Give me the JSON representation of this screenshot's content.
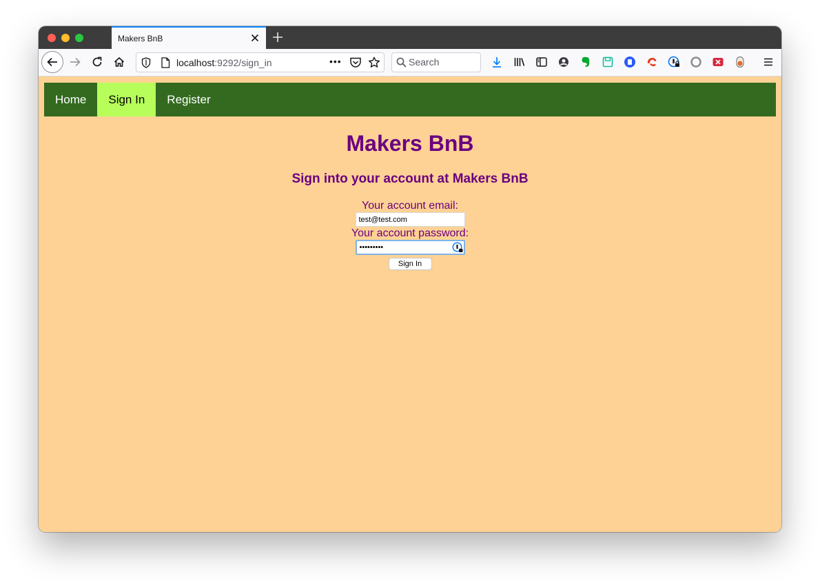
{
  "browser": {
    "tab_title": "Makers BnB",
    "url_host": "localhost",
    "url_rest": ":9292/sign_in",
    "search_placeholder": "Search",
    "page_actions_glyph": "•••"
  },
  "icons": [
    "back-arrow-icon",
    "forward-arrow-icon",
    "reload-icon",
    "home-icon",
    "shield-icon",
    "page-icon",
    "pocket-icon",
    "star-icon",
    "search-icon",
    "download-icon",
    "library-icon",
    "sidebar-icon",
    "account-icon",
    "evernote-icon",
    "save-icon",
    "extension-blue-icon",
    "extension-red-icon",
    "password-manager-icon",
    "extension-grey-icon",
    "extension-close-icon",
    "extension-toggle-icon",
    "menu-icon"
  ],
  "colors": {
    "nav_bg": "#336a1f",
    "nav_active": "#b7fe5b",
    "page_bg": "#fed294",
    "heading": "#6a0080"
  },
  "nav": {
    "items": [
      {
        "label": "Home"
      },
      {
        "label": "Sign In"
      },
      {
        "label": "Register"
      }
    ]
  },
  "main": {
    "title": "Makers BnB",
    "subtitle": "Sign into your account at Makers BnB"
  },
  "form": {
    "email_label": "Your account email:",
    "email_value": "test@test.com",
    "password_label": "Your account password:",
    "password_value": "password1",
    "submit_label": "Sign In"
  }
}
